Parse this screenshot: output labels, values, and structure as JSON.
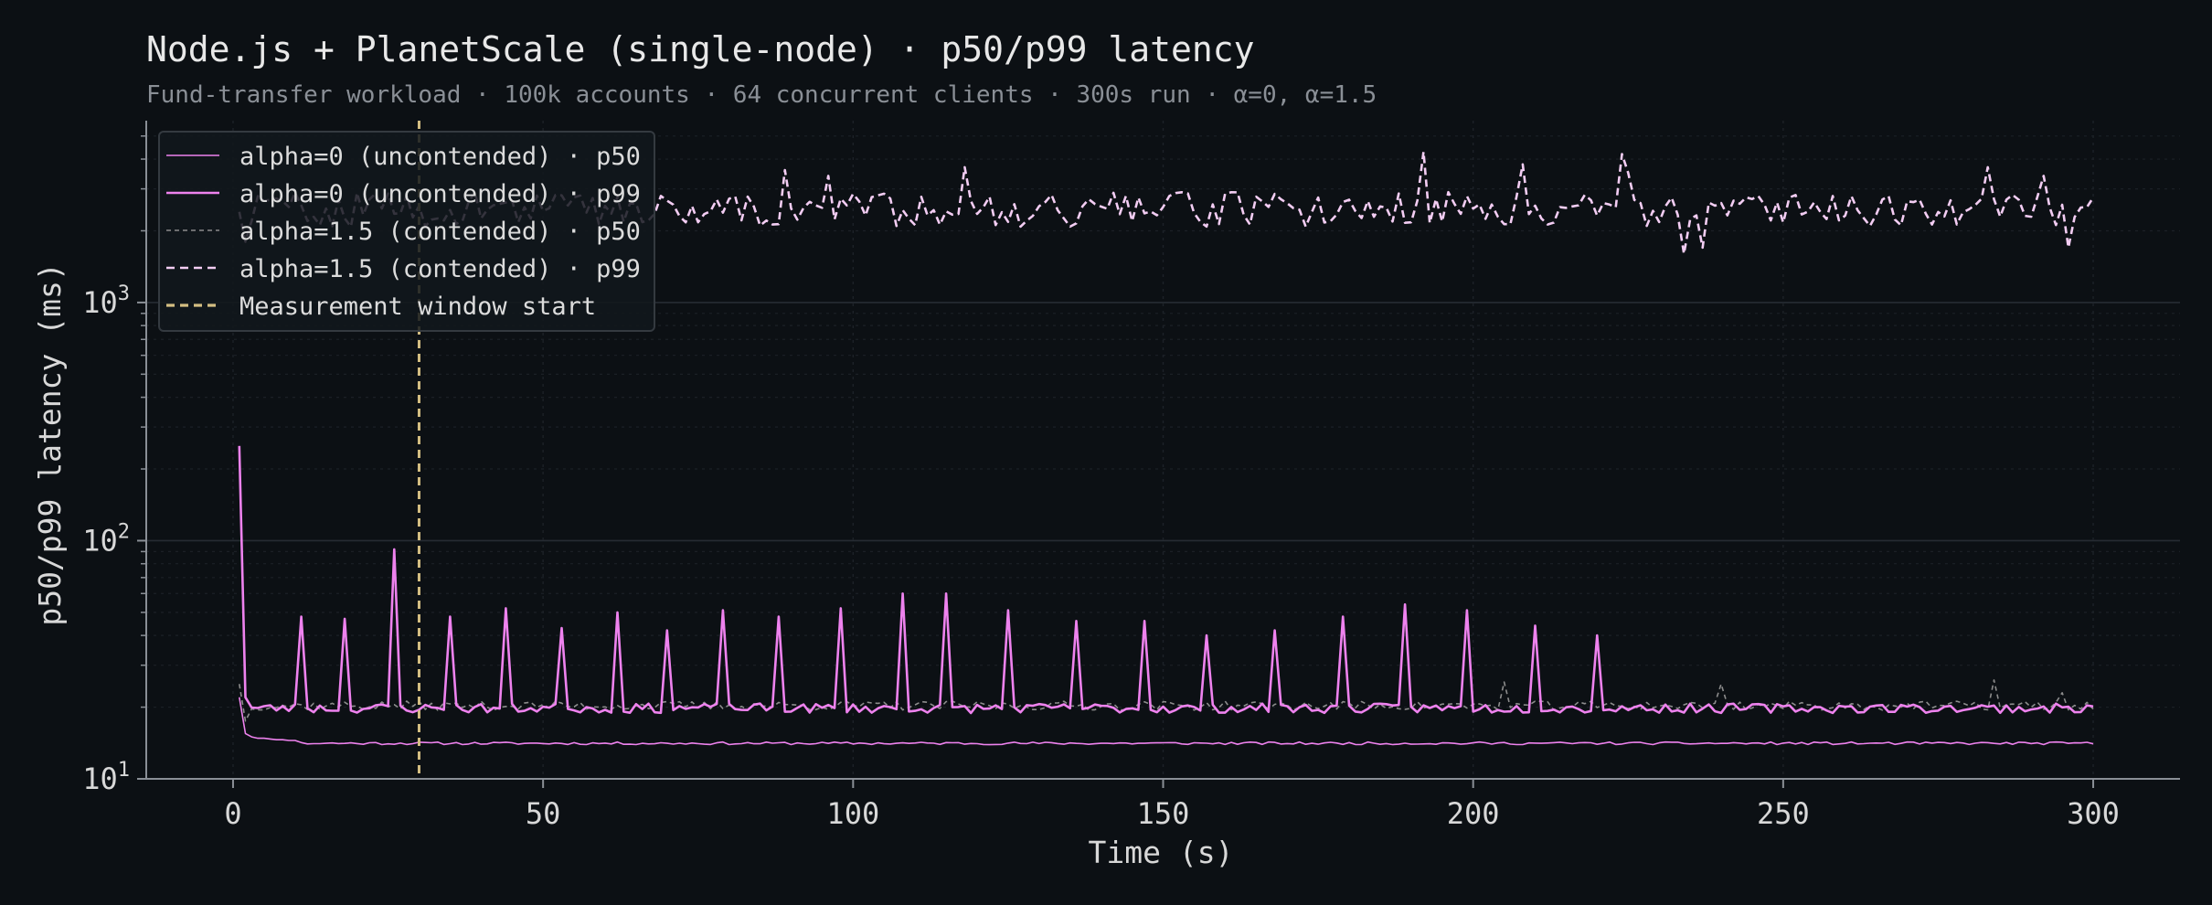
{
  "chart_data": {
    "type": "line",
    "title": "Node.js + PlanetScale (single-node) · p50/p99 latency",
    "subtitle": "Fund-transfer workload · 100k accounts · 64 concurrent clients · 300s run · α=0, α=1.5",
    "xlabel": "Time (s)",
    "ylabel": "p50/p99 latency (ms)",
    "xlim": [
      -14,
      314
    ],
    "ylim": [
      10,
      5800
    ],
    "yscale": "log",
    "grid": true,
    "legend_position": "top-left",
    "x_ticks": [
      0,
      50,
      100,
      150,
      200,
      250,
      300
    ],
    "y_ticks": [
      {
        "value": 10,
        "base": "10",
        "exp": "1"
      },
      {
        "value": 100,
        "base": "10",
        "exp": "2"
      },
      {
        "value": 1000,
        "base": "10",
        "exp": "3"
      }
    ],
    "measurement_window_start": 30,
    "x_start": 1,
    "x_step": 1,
    "series": [
      {
        "name": "alpha=0 (uncontended) · p50",
        "color": "#ee82ee",
        "style": "solid",
        "width": "thin",
        "base": 14.1,
        "noise": 0.18,
        "seed": 11,
        "overrides": [
          [
            1,
            22
          ],
          [
            2,
            15.5
          ],
          [
            3,
            15
          ],
          [
            4,
            14.8
          ],
          [
            5,
            14.8
          ],
          [
            6,
            14.7
          ],
          [
            7,
            14.6
          ],
          [
            8,
            14.6
          ],
          [
            9,
            14.5
          ],
          [
            10,
            14.5
          ]
        ]
      },
      {
        "name": "alpha=0 (uncontended) · p99",
        "color": "#ee82ee",
        "style": "solid",
        "width": "thick",
        "base": 19.8,
        "noise": 0.9,
        "seed": 23,
        "overrides": [
          [
            1,
            250
          ],
          [
            2,
            22
          ],
          [
            11,
            48
          ],
          [
            18,
            47
          ],
          [
            26,
            92
          ],
          [
            35,
            48
          ],
          [
            44,
            52
          ],
          [
            53,
            43
          ],
          [
            62,
            50
          ],
          [
            70,
            42
          ],
          [
            79,
            51
          ],
          [
            88,
            48
          ],
          [
            98,
            52
          ],
          [
            108,
            60
          ],
          [
            115,
            60
          ],
          [
            125,
            51
          ],
          [
            136,
            46
          ],
          [
            147,
            46
          ],
          [
            157,
            40
          ],
          [
            168,
            42
          ],
          [
            179,
            48
          ],
          [
            189,
            54
          ],
          [
            199,
            51
          ],
          [
            210,
            44
          ],
          [
            220,
            40
          ]
        ]
      },
      {
        "name": "alpha=1.5 (contended) · p50",
        "color": "#8c8c8c",
        "style": "dashed",
        "width": "thin",
        "base": 20.3,
        "noise": 0.9,
        "seed": 37,
        "overrides": [
          [
            1,
            25
          ],
          [
            2,
            17.5
          ],
          [
            205,
            25.5
          ],
          [
            240,
            25
          ],
          [
            284,
            26
          ],
          [
            295,
            23
          ]
        ]
      },
      {
        "name": "alpha=1.5 (contended) · p99",
        "color": "#f3cdf3",
        "style": "dashed",
        "width": "thick",
        "base": 2500,
        "noise": 420,
        "seed": 59,
        "overrides": [
          [
            1,
            2400
          ],
          [
            2,
            1800
          ],
          [
            3,
            2200
          ],
          [
            89,
            3600
          ],
          [
            96,
            3400
          ],
          [
            118,
            3700
          ],
          [
            192,
            4300
          ],
          [
            208,
            3800
          ],
          [
            224,
            4200
          ],
          [
            225,
            3500
          ],
          [
            234,
            1600
          ],
          [
            237,
            1700
          ],
          [
            296,
            1700
          ],
          [
            292,
            3400
          ],
          [
            283,
            3700
          ]
        ]
      },
      {
        "name": "Measurement window start",
        "color": "#d4be82",
        "style": "dashed",
        "width": "thick"
      }
    ]
  }
}
